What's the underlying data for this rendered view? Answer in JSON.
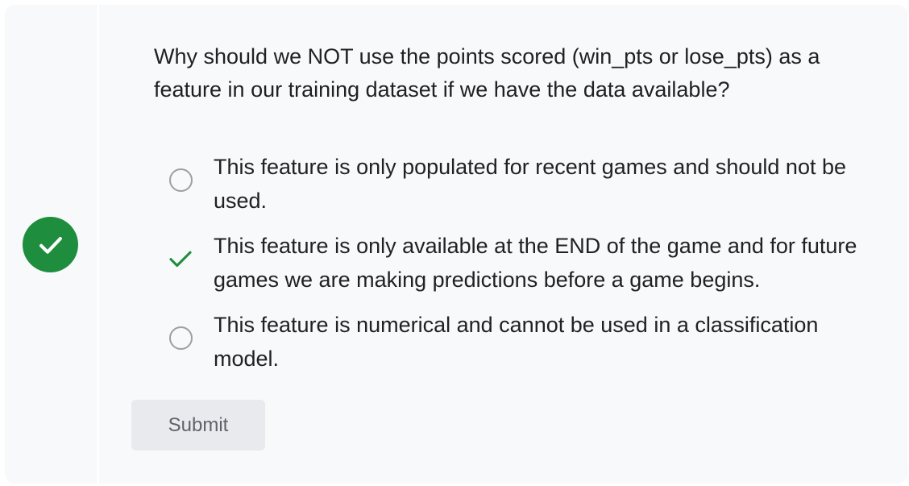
{
  "question": {
    "text": "Why should we NOT use the points scored (win_pts or lose_pts) as a feature in our training dataset if we have the data available?",
    "status": "correct",
    "status_icon": "check-icon",
    "status_color": "#1e8e3e"
  },
  "options": [
    {
      "label": "This feature is only populated for recent games and should not be used.",
      "state": "unselected",
      "icon": "radio-circle-icon"
    },
    {
      "label": "This feature is only available at the END of the game and for future games we are making predictions before a game begins.",
      "state": "correct",
      "icon": "check-icon"
    },
    {
      "label": "This feature is numerical and cannot be used in a classification model.",
      "state": "unselected",
      "icon": "radio-circle-icon"
    }
  ],
  "submit": {
    "label": "Submit"
  }
}
